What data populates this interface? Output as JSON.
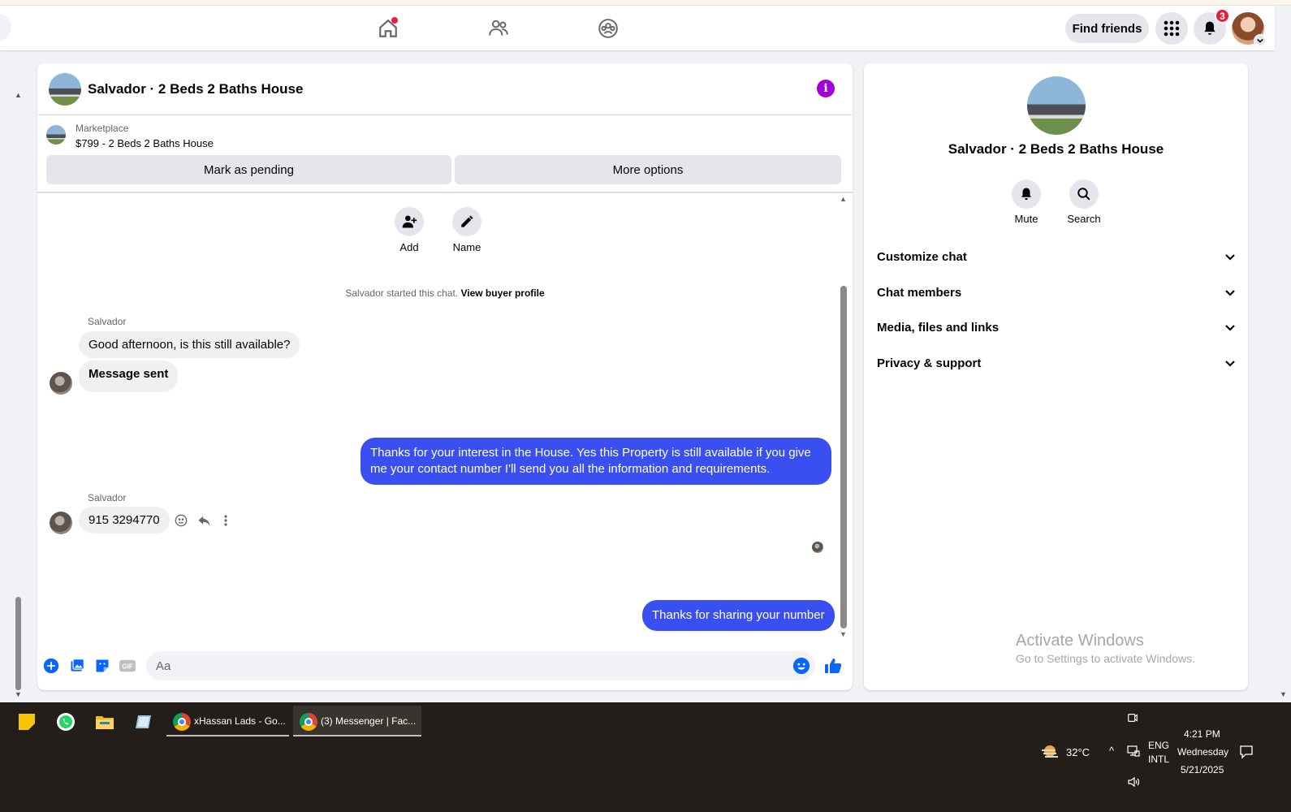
{
  "topbar": {
    "nav": [
      "home-icon",
      "friends-icon",
      "groups-icon"
    ],
    "find_friends_label": "Find friends",
    "notification_count": "3"
  },
  "chat": {
    "title": "Salvador · 2 Beds 2 Baths House",
    "marketplace_label": "Marketplace",
    "listing": "$799 - 2 Beds 2 Baths House",
    "mark_pending_label": "Mark as pending",
    "more_options_label": "More options",
    "quick_actions": [
      {
        "label": "Add",
        "icon": "add-person-icon"
      },
      {
        "label": "Name",
        "icon": "pencil-icon"
      }
    ],
    "system_message": "Salvador started this chat.",
    "system_link": "View buyer profile",
    "messages": [
      {
        "sender": "Salvador",
        "text": "Good afternoon, is this still available?",
        "direction": "in"
      },
      {
        "text": "Message sent",
        "direction": "in"
      },
      {
        "text": "Thanks for your interest in the House. Yes this Property is still available if you give me your contact number I'll send you all the information and requirements.",
        "direction": "out"
      },
      {
        "sender": "Salvador",
        "text": "915 3294770",
        "direction": "in"
      },
      {
        "text": "Thanks for sharing your number",
        "direction": "out"
      }
    ],
    "composer_placeholder": "Aa"
  },
  "info_panel": {
    "title": "Salvador · 2 Beds 2 Baths House",
    "actions": [
      {
        "label": "Mute",
        "icon": "bell-icon"
      },
      {
        "label": "Search",
        "icon": "search-icon"
      }
    ],
    "sections": [
      "Customize chat",
      "Chat members",
      "Media, files and links",
      "Privacy & support"
    ],
    "watermark_title": "Activate Windows",
    "watermark_sub": "Go to Settings to activate Windows."
  },
  "taskbar": {
    "tasks": [
      "xHassan Lads - Go...",
      "(3) Messenger | Fac..."
    ],
    "weather": "32°C",
    "lang_1": "ENG",
    "lang_2": "INTL",
    "time": "4:21 PM",
    "day": "Wednesday",
    "date": "5/21/2025"
  },
  "colors": {
    "accent": "#0866ff",
    "outgoing_bubble": "#3a4ff0",
    "info_icon": "#a200d6",
    "badge": "#e41e3f"
  }
}
